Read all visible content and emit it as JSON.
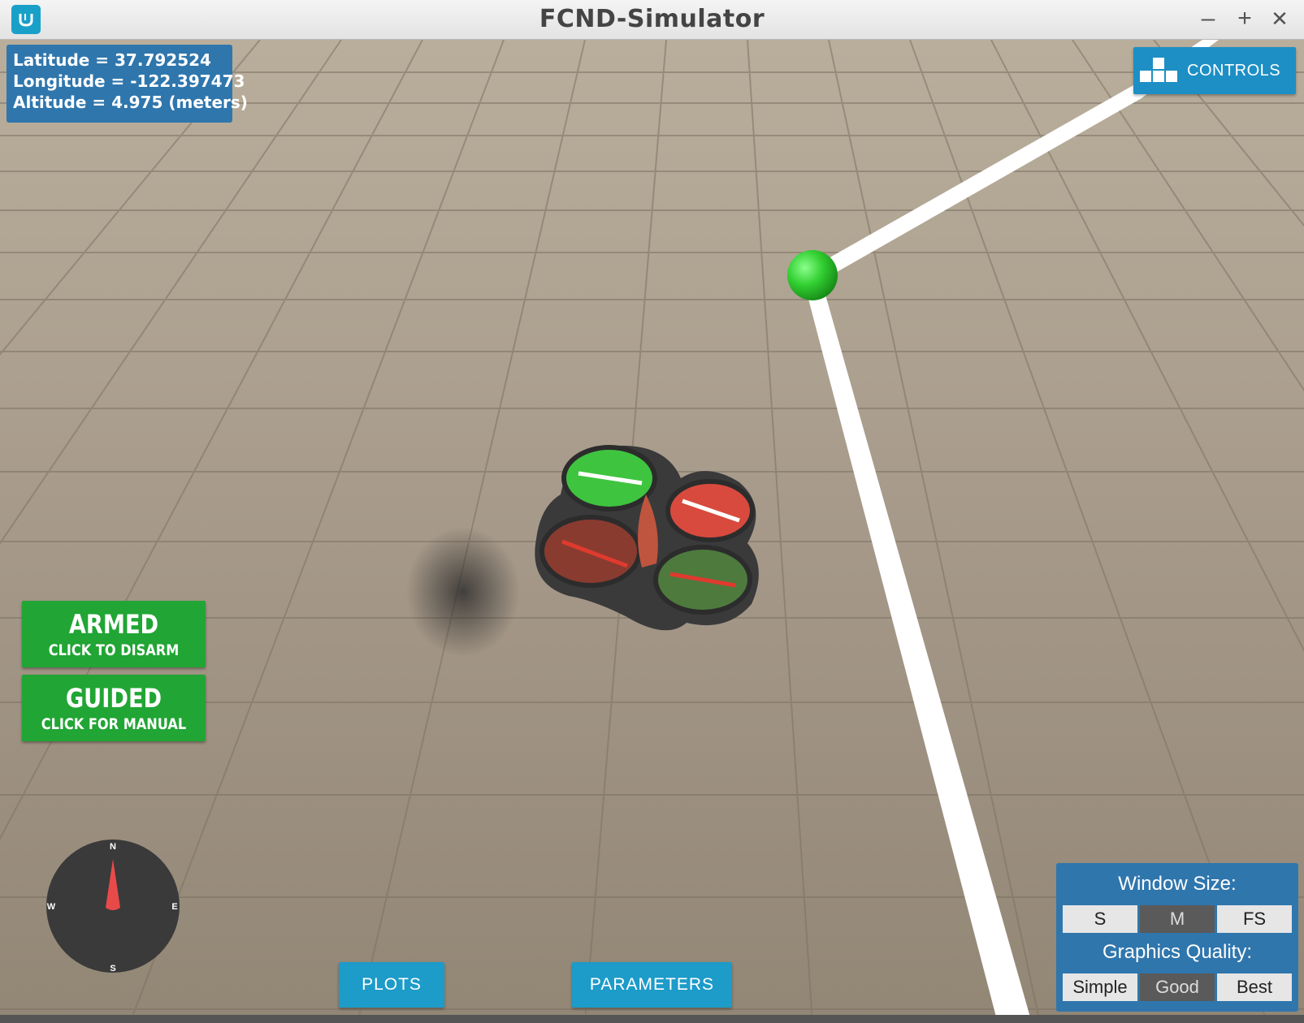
{
  "window": {
    "title": "FCND-Simulator",
    "minimize_glyph": "–",
    "maximize_glyph": "+",
    "close_glyph": "✕",
    "app_icon": "udacity-logo-icon"
  },
  "telemetry": {
    "latitude": "Latitude = 37.792524",
    "longitude": "Longitude = -122.397473",
    "altitude": "Altitude = 4.975 (meters)"
  },
  "controls_button": {
    "label": "CONTROLS",
    "icon": "controls-blocks-icon"
  },
  "armed_button": {
    "title": "ARMED",
    "subtitle": "CLICK TO DISARM",
    "color": "#21a534"
  },
  "guided_button": {
    "title": "GUIDED",
    "subtitle": "CLICK FOR MANUAL",
    "color": "#21a534"
  },
  "bottom_buttons": {
    "plots": "PLOTS",
    "parameters": "PARAMETERS"
  },
  "settings": {
    "window_size_label": "Window Size:",
    "window_size_options": [
      "S",
      "M",
      "FS"
    ],
    "window_size_selected": "M",
    "graphics_quality_label": "Graphics Quality:",
    "graphics_quality_options": [
      "Simple",
      "Good",
      "Best"
    ],
    "graphics_quality_selected": "Good"
  },
  "compass": {
    "n": "N",
    "e": "E",
    "s": "S",
    "w": "W"
  },
  "colors": {
    "panel_blue": "#2f76ad",
    "button_blue": "#1d9bc9",
    "armed_green": "#21a534",
    "waypoint_green": "#3cd23c"
  }
}
